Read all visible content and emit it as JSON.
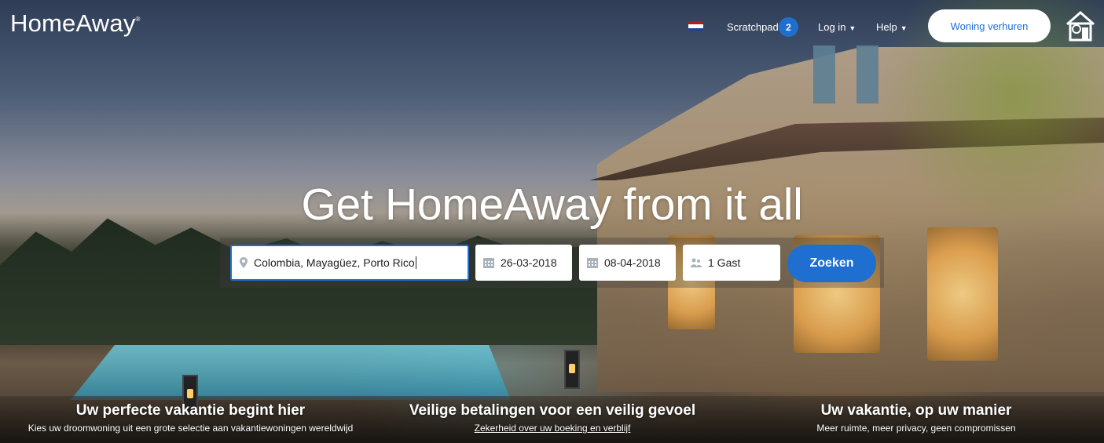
{
  "header": {
    "logo_text": "HomeAway",
    "logo_mark": "®",
    "flag_colors": [
      "#ae1c28",
      "#ffffff",
      "#21468b"
    ],
    "scratchpad_label": "Scratchpad",
    "scratchpad_count": "2",
    "login_label": "Log in",
    "help_label": "Help",
    "list_property_label": "Woning verhuren",
    "home_icon": "house-icon"
  },
  "hero": {
    "headline": "Get HomeAway from it all"
  },
  "search": {
    "destination_value": "Colombia, Mayagüez, Porto Rico",
    "destination_icon": "map-pin-icon",
    "checkin_value": "26-03-2018",
    "checkout_value": "08-04-2018",
    "calendar_icon": "calendar-icon",
    "guests_value": "1 Gast",
    "guests_icon": "people-icon",
    "search_button_label": "Zoeken"
  },
  "value_props": [
    {
      "title": "Uw perfecte vakantie begint hier",
      "subtitle": "Kies uw droomwoning uit een grote selectie aan vakantiewoningen wereldwijd"
    },
    {
      "title": "Veilige betalingen voor een veilig gevoel",
      "subtitle": "Zekerheid over uw boeking en verblijf"
    },
    {
      "title": "Uw vakantie, op uw manier",
      "subtitle": "Meer ruimte, meer privacy, geen compromissen"
    }
  ],
  "colors": {
    "accent": "#1f6fd1",
    "text_on_image": "#ffffff"
  }
}
